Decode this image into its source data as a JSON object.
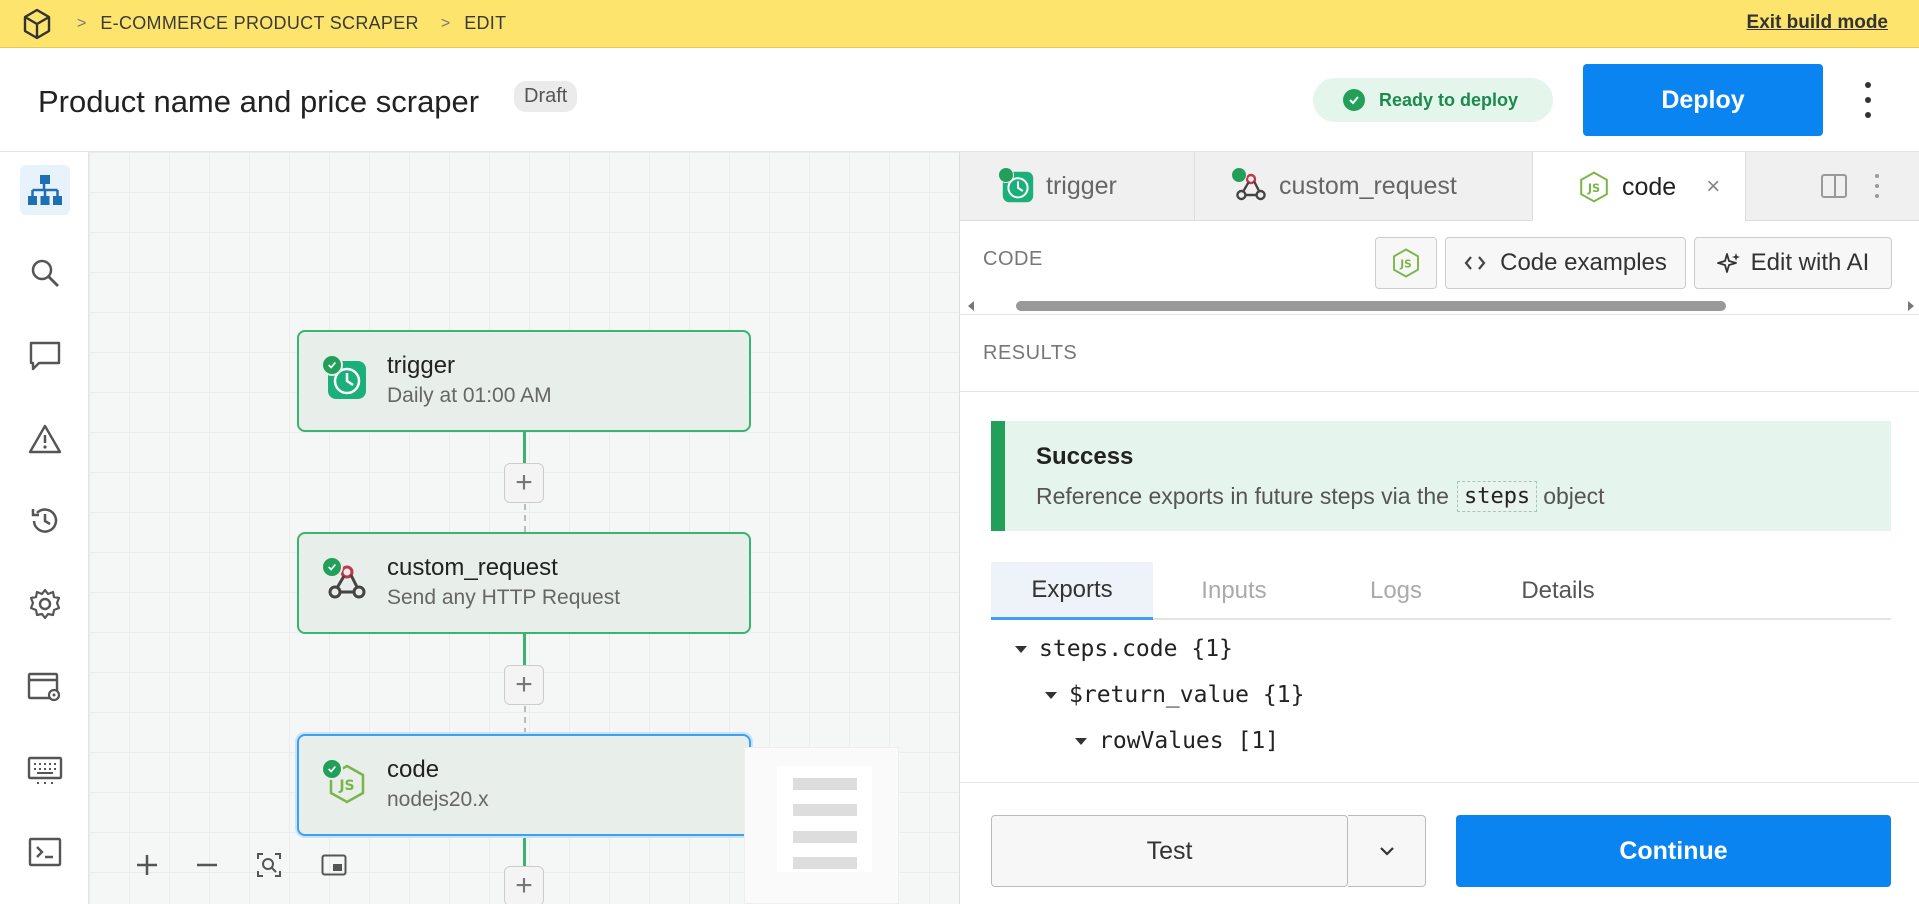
{
  "banner": {
    "breadcrumb": [
      "E-COMMERCE PRODUCT SCRAPER",
      "EDIT"
    ],
    "exit_label": "Exit build mode"
  },
  "header": {
    "title": "Product name and price scraper",
    "badge": "Draft",
    "status": "Ready to deploy",
    "deploy_label": "Deploy"
  },
  "sidebar": {
    "items": [
      "workflow-icon",
      "search-icon",
      "comment-icon",
      "warning-icon",
      "history-icon",
      "gear-icon",
      "app-settings-icon",
      "keyboard-icon",
      "terminal-icon"
    ]
  },
  "canvas": {
    "nodes": [
      {
        "title": "trigger",
        "subtitle": "Daily at 01:00 AM",
        "icon": "clock-icon"
      },
      {
        "title": "custom_request",
        "subtitle": "Send any HTTP Request",
        "icon": "webhook-icon"
      },
      {
        "title": "code",
        "subtitle": "nodejs20.x",
        "icon": "nodejs-icon"
      }
    ],
    "add_symbol": "+"
  },
  "panel": {
    "tabs": [
      {
        "label": "trigger",
        "icon": "clock-icon"
      },
      {
        "label": "custom_request",
        "icon": "webhook-icon"
      },
      {
        "label": "code",
        "icon": "nodejs-icon"
      }
    ],
    "close_symbol": "×",
    "code_label": "CODE",
    "code_examples_label": "Code examples",
    "edit_ai_label": "Edit with AI",
    "results_label": "RESULTS",
    "success": {
      "title": "Success",
      "body_before": "Reference exports in future steps via the",
      "chip": "steps",
      "body_after": "object"
    },
    "result_tabs": [
      "Exports",
      "Inputs",
      "Logs",
      "Details"
    ],
    "tree": [
      {
        "key": "steps.code",
        "meta": "{1}"
      },
      {
        "key": "$return_value",
        "meta": "{1}"
      },
      {
        "key": "rowValues",
        "meta": "[1]"
      }
    ],
    "test_label": "Test",
    "continue_label": "Continue"
  },
  "colors": {
    "banner": "#fde56d",
    "accent": "#0a84f0",
    "success": "#22a05a"
  }
}
